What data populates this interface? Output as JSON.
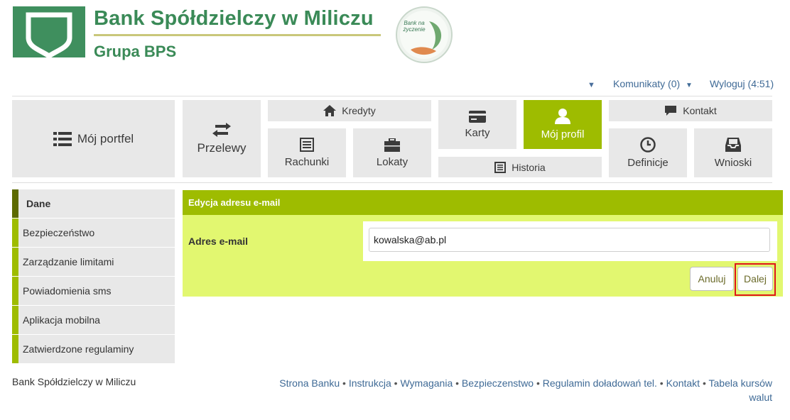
{
  "brand": {
    "name": "Bank Spółdzielczy w Miliczu",
    "group": "Grupa BPS",
    "badge_text": "Bank na życzenie"
  },
  "topbar": {
    "messages_label": "Komunikaty (0)",
    "logout_label": "Wyloguj (4:51)"
  },
  "nav": {
    "portfolio": "Mój portfel",
    "transfers": "Przelewy",
    "credits": "Kredyty",
    "accounts": "Rachunki",
    "deposits": "Lokaty",
    "cards": "Karty",
    "history": "Historia",
    "profile": "Mój profil",
    "contact": "Kontakt",
    "definitions": "Definicje",
    "applications": "Wnioski"
  },
  "sidebar": {
    "items": [
      {
        "label": "Dane"
      },
      {
        "label": "Bezpieczeństwo"
      },
      {
        "label": "Zarządzanie limitami"
      },
      {
        "label": "Powiadomienia sms"
      },
      {
        "label": "Aplikacja mobilna"
      },
      {
        "label": "Zatwierdzone regulaminy"
      }
    ]
  },
  "form": {
    "title": "Edycja adresu e-mail",
    "email_label": "Adres e-mail",
    "email_value": "kowalska@ab.pl",
    "cancel_label": "Anuluj",
    "next_label": "Dalej"
  },
  "footer": {
    "bank_name": "Bank Spółdzielczy w Miliczu",
    "links": [
      "Strona Banku",
      "Instrukcja",
      "Wymagania",
      "Bezpieczenstwo",
      "Regulamin doładowań tel.",
      "Kontakt",
      "Tabela kursów walut"
    ]
  },
  "colors": {
    "brand_green": "#3a8a57",
    "accent": "#9ebc00",
    "panel_bg": "#e2f770",
    "link": "#3f6a96",
    "highlight": "#e0151b"
  }
}
